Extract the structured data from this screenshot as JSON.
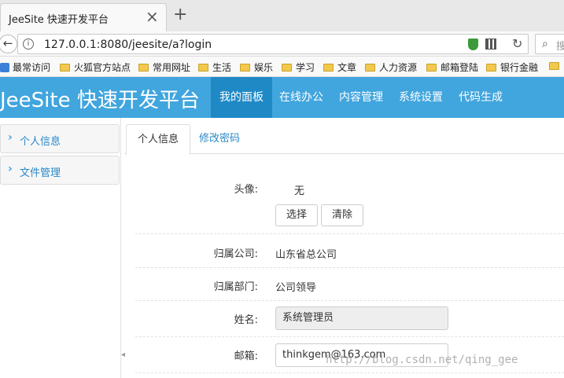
{
  "browser": {
    "tab_title": "JeeSite 快速开发平台",
    "url": "127.0.0.1:8080/jeesite/a?login",
    "search_hint": "搜"
  },
  "bookmarks": [
    {
      "label": "最常访问",
      "icon": "visited-icon"
    },
    {
      "label": "火狐官方站点",
      "icon": "folder-icon"
    },
    {
      "label": "常用网址",
      "icon": "folder-icon"
    },
    {
      "label": "生活",
      "icon": "folder-icon"
    },
    {
      "label": "娱乐",
      "icon": "folder-icon"
    },
    {
      "label": "学习",
      "icon": "folder-icon"
    },
    {
      "label": "文章",
      "icon": "folder-icon"
    },
    {
      "label": "人力资源",
      "icon": "folder-icon"
    },
    {
      "label": "邮箱登陆",
      "icon": "folder-icon"
    },
    {
      "label": "银行金融",
      "icon": "folder-icon"
    }
  ],
  "app": {
    "brand": "JeeSite 快速开发平台",
    "menu": [
      "我的面板",
      "在线办公",
      "内容管理",
      "系统设置",
      "代码生成"
    ],
    "active_menu": "我的面板",
    "accent_color": "#41a5de",
    "active_color": "#1f89c6"
  },
  "sidebar": {
    "items": [
      "个人信息",
      "文件管理"
    ]
  },
  "tabs": [
    "个人信息",
    "修改密码"
  ],
  "form": {
    "avatar_label": "头像:",
    "avatar_value": "无",
    "choose_button": "选择",
    "clear_button": "清除",
    "company_label": "归属公司:",
    "company_value": "山东省总公司",
    "dept_label": "归属部门:",
    "dept_value": "公司领导",
    "name_label": "姓名:",
    "name_value": "系统管理员",
    "email_label": "邮箱:",
    "email_value": "thinkgem@163.com"
  },
  "watermark": "http://blog.csdn.net/qing_gee"
}
